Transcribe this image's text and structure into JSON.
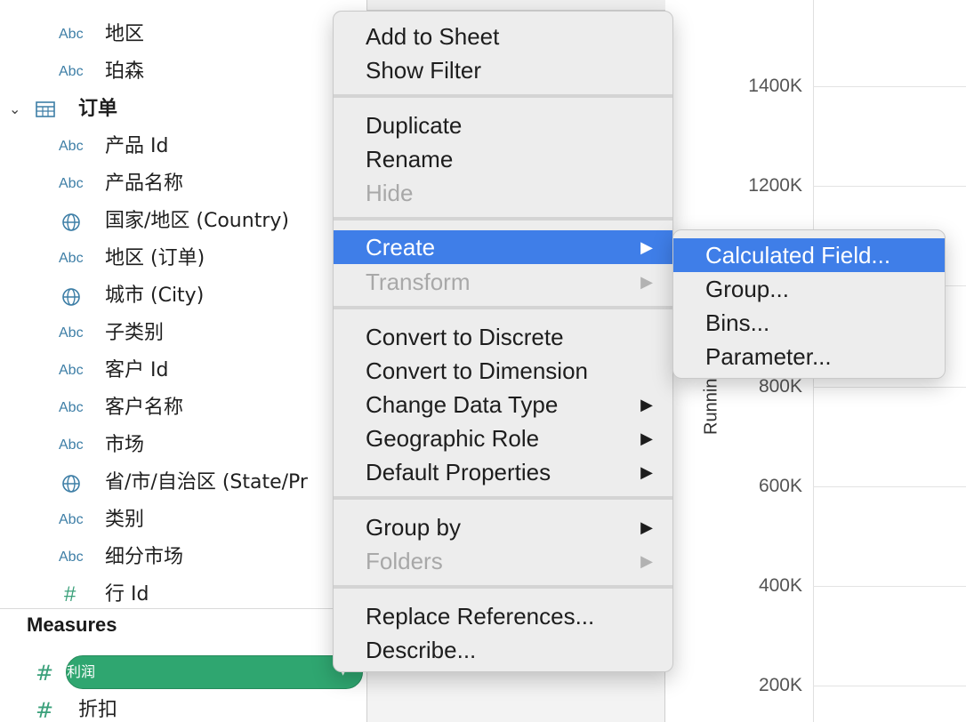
{
  "data_pane": {
    "fields_top": [
      {
        "type": "Abc",
        "label": "地区"
      },
      {
        "type": "Abc",
        "label": "珀森"
      }
    ],
    "folder": {
      "chevron": "⌄",
      "label": "订单"
    },
    "fields": [
      {
        "type": "Abc",
        "label": "产品 Id"
      },
      {
        "type": "Abc",
        "label": "产品名称"
      },
      {
        "type": "globe",
        "label": "国家/地区 (Country)"
      },
      {
        "type": "Abc",
        "label": "地区 (订单)"
      },
      {
        "type": "globe",
        "label": "城市 (City)"
      },
      {
        "type": "Abc",
        "label": "子类别"
      },
      {
        "type": "Abc",
        "label": "客户 Id"
      },
      {
        "type": "Abc",
        "label": "客户名称"
      },
      {
        "type": "Abc",
        "label": "市场"
      },
      {
        "type": "globe",
        "label": "省/市/自治区 (State/Pr"
      },
      {
        "type": "Abc",
        "label": "类别"
      },
      {
        "type": "Abc",
        "label": "细分市场"
      },
      {
        "type": "#",
        "label": "行 Id"
      }
    ],
    "measures_title": "Measures",
    "measures": [
      {
        "type": "#",
        "label": "利润",
        "selected": true
      },
      {
        "type": "#",
        "label": "折扣",
        "selected": false
      }
    ]
  },
  "chart": {
    "axis_title": "Running Sum o",
    "ticks": [
      "1400K",
      "1200K",
      "800K",
      "600K",
      "400K",
      "200K"
    ]
  },
  "context_menu": {
    "items": [
      {
        "label": "Add to Sheet",
        "disabled": false,
        "submenu": false
      },
      {
        "label": "Show Filter",
        "disabled": false,
        "submenu": false
      },
      {
        "label": "Duplicate",
        "disabled": false,
        "submenu": false
      },
      {
        "label": "Rename",
        "disabled": false,
        "submenu": false
      },
      {
        "label": "Hide",
        "disabled": true,
        "submenu": false
      },
      {
        "label": "Create",
        "disabled": false,
        "submenu": true,
        "active": true
      },
      {
        "label": "Transform",
        "disabled": true,
        "submenu": true
      },
      {
        "label": "Convert to Discrete",
        "disabled": false,
        "submenu": false
      },
      {
        "label": "Convert to Dimension",
        "disabled": false,
        "submenu": false
      },
      {
        "label": "Change Data Type",
        "disabled": false,
        "submenu": true
      },
      {
        "label": "Geographic Role",
        "disabled": false,
        "submenu": true
      },
      {
        "label": "Default Properties",
        "disabled": false,
        "submenu": true
      },
      {
        "label": "Group by",
        "disabled": false,
        "submenu": true
      },
      {
        "label": "Folders",
        "disabled": true,
        "submenu": true
      },
      {
        "label": "Replace References...",
        "disabled": false,
        "submenu": false
      },
      {
        "label": "Describe...",
        "disabled": false,
        "submenu": false
      }
    ]
  },
  "create_submenu": {
    "items": [
      {
        "label": "Calculated Field...",
        "active": true
      },
      {
        "label": "Group..."
      },
      {
        "label": "Bins..."
      },
      {
        "label": "Parameter..."
      }
    ]
  },
  "colors": {
    "menu_highlight": "#3f7ee8",
    "pill_green": "#2fa670",
    "abc_blue": "#3d7ea6",
    "measure_green": "#3aa07a"
  }
}
